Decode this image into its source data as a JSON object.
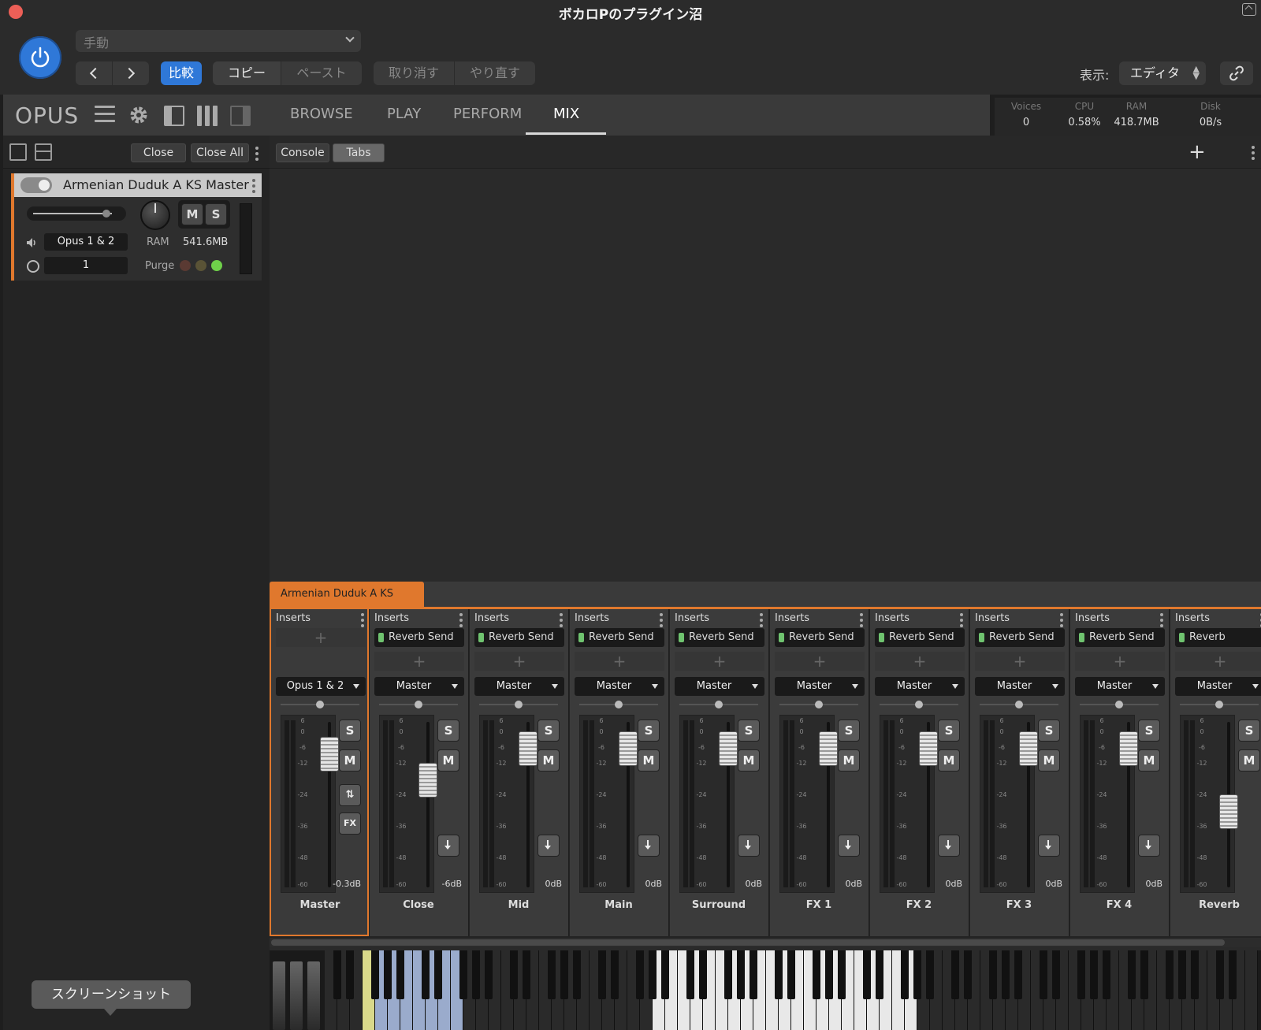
{
  "window": {
    "title": "ボカロPのプラグイン沼"
  },
  "host": {
    "preset": "手動",
    "compare": "比較",
    "copy": "コピー",
    "paste": "ペースト",
    "undo": "取り消す",
    "redo": "やり直す",
    "view_label": "表示:",
    "view_value": "エディタ",
    "power_color": "#2f78d8"
  },
  "plugin": {
    "logo": "OPUS",
    "tabs": [
      "BROWSE",
      "PLAY",
      "PERFORM",
      "MIX"
    ],
    "active_tab": "MIX",
    "stats": [
      {
        "label": "Voices",
        "value": "0"
      },
      {
        "label": "CPU",
        "value": "0.58%"
      },
      {
        "label": "RAM",
        "value": "418.7MB"
      },
      {
        "label": "Disk",
        "value": "0B/s"
      }
    ]
  },
  "left_panel": {
    "close": "Close",
    "close_all": "Close All",
    "instrument": {
      "name": "Armenian Duduk A KS Master",
      "mute": "M",
      "solo": "S",
      "output": "Opus 1 & 2",
      "ram_label": "RAM",
      "ram_value": "541.6MB",
      "midi_channel": "1",
      "purge_label": "Purge",
      "accent_color": "#e0782d"
    }
  },
  "main": {
    "console": "Console",
    "tabs": "Tabs"
  },
  "mixer": {
    "tab_label": "Armenian Duduk A KS Master",
    "inserts_label": "Inserts",
    "scale": [
      "6",
      "0",
      "-6",
      "-12",
      "-24",
      "-36",
      "-48",
      "-60"
    ],
    "strips": [
      {
        "name": "Master",
        "send": "",
        "output": "Opus 1 & 2",
        "gain": "-0.3dB",
        "fader_db": -8
      },
      {
        "name": "Close",
        "send": "Reverb Send",
        "output": "Master",
        "gain": "-6dB",
        "fader_db": -18
      },
      {
        "name": "Mid",
        "send": "Reverb Send",
        "output": "Master",
        "gain": "0dB",
        "fader_db": -6
      },
      {
        "name": "Main",
        "send": "Reverb Send",
        "output": "Master",
        "gain": "0dB",
        "fader_db": -6
      },
      {
        "name": "Surround",
        "send": "Reverb Send",
        "output": "Master",
        "gain": "0dB",
        "fader_db": -6
      },
      {
        "name": "FX 1",
        "send": "Reverb Send",
        "output": "Master",
        "gain": "0dB",
        "fader_db": -6
      },
      {
        "name": "FX 2",
        "send": "Reverb Send",
        "output": "Master",
        "gain": "0dB",
        "fader_db": -6
      },
      {
        "name": "FX 3",
        "send": "Reverb Send",
        "output": "Master",
        "gain": "0dB",
        "fader_db": -6
      },
      {
        "name": "FX 4",
        "send": "Reverb Send",
        "output": "Master",
        "gain": "0dB",
        "fader_db": -6
      },
      {
        "name": "Reverb",
        "send": "Reverb",
        "output": "Master",
        "gain": "",
        "fader_db": -30
      }
    ]
  },
  "tooltip": "スクリーンショット"
}
